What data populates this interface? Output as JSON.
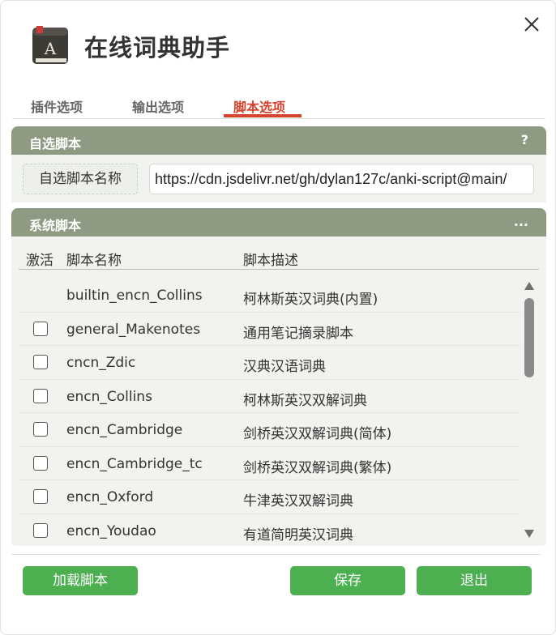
{
  "app": {
    "title": "在线词典助手",
    "icon": "dictionary-book-icon"
  },
  "tabs": [
    {
      "label": "插件选项",
      "active": false
    },
    {
      "label": "输出选项",
      "active": false
    },
    {
      "label": "脚本选项",
      "active": true
    }
  ],
  "custom_script": {
    "header": "自选脚本",
    "help": "?",
    "label": "自选脚本名称",
    "value": "https://cdn.jsdelivr.net/gh/dylan127c/anki-script@main/"
  },
  "system_script": {
    "header": "系统脚本",
    "more": "...",
    "columns": {
      "active": "激活",
      "name": "脚本名称",
      "desc": "脚本描述"
    },
    "rows": [
      {
        "name": "builtin_encn_Collins",
        "desc": "柯林斯英汉词典(内置)",
        "has_checkbox": false
      },
      {
        "name": "general_Makenotes",
        "desc": "通用笔记摘录脚本",
        "has_checkbox": true
      },
      {
        "name": "cncn_Zdic",
        "desc": "汉典汉语词典",
        "has_checkbox": true
      },
      {
        "name": "encn_Collins",
        "desc": "柯林斯英汉双解词典",
        "has_checkbox": true
      },
      {
        "name": "encn_Cambridge",
        "desc": "剑桥英汉双解词典(简体)",
        "has_checkbox": true
      },
      {
        "name": "encn_Cambridge_tc",
        "desc": "剑桥英汉双解词典(繁体)",
        "has_checkbox": true
      },
      {
        "name": "encn_Oxford",
        "desc": "牛津英汉双解词典",
        "has_checkbox": true
      },
      {
        "name": "encn_Youdao",
        "desc": "有道简明英汉词典",
        "has_checkbox": true
      }
    ]
  },
  "buttons": {
    "load": "加载脚本",
    "save": "保存",
    "exit": "退出"
  },
  "colors": {
    "accent": "#d7422d",
    "panel_header": "#8e9b82",
    "button": "#4caf50"
  }
}
